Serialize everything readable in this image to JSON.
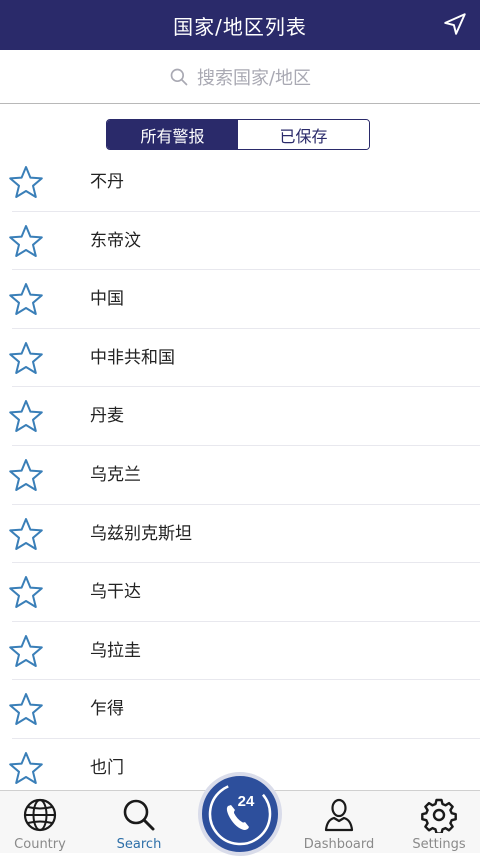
{
  "header": {
    "title": "国家/地区列表",
    "locate_icon": "location-arrow-icon"
  },
  "search": {
    "placeholder": "搜索国家/地区",
    "icon": "search-icon"
  },
  "segment": {
    "all_alerts": "所有警报",
    "saved": "已保存",
    "active": "all_alerts"
  },
  "countries": [
    {
      "name": "不丹"
    },
    {
      "name": "东帝汶"
    },
    {
      "name": "中国"
    },
    {
      "name": "中非共和国"
    },
    {
      "name": "丹麦"
    },
    {
      "name": "乌克兰"
    },
    {
      "name": "乌兹别克斯坦"
    },
    {
      "name": "乌干达"
    },
    {
      "name": "乌拉圭"
    },
    {
      "name": "乍得"
    },
    {
      "name": "也门"
    }
  ],
  "tabs": {
    "country": "Country",
    "search": "Search",
    "dashboard": "Dashboard",
    "settings": "Settings",
    "center_badge": "24",
    "active": "search"
  },
  "colors": {
    "navy": "#2a2a6a",
    "star_blue": "#3a7fb8",
    "tab_active": "#2d6fa8",
    "center_blue": "#2d4f9c"
  }
}
